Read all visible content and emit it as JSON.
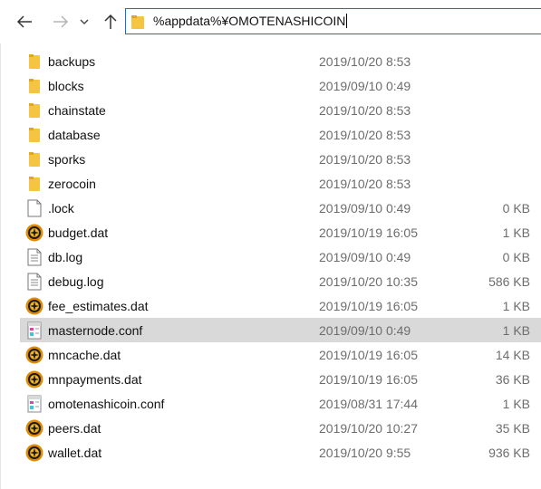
{
  "address_bar": {
    "path": "%appdata%¥OMOTENASHICOIN"
  },
  "colors": {
    "folder": "#f5c542",
    "selection": "#d9d9d9",
    "coin_outer": "#e08a00",
    "coin_inner": "#1a1a1a",
    "accent_border": "#0a74d6"
  },
  "files": [
    {
      "name": "backups",
      "date": "2019/10/20 8:53",
      "size": "",
      "icon": "folder-icon"
    },
    {
      "name": "blocks",
      "date": "2019/09/10 0:49",
      "size": "",
      "icon": "folder-icon"
    },
    {
      "name": "chainstate",
      "date": "2019/10/20 8:53",
      "size": "",
      "icon": "folder-icon"
    },
    {
      "name": "database",
      "date": "2019/10/20 8:53",
      "size": "",
      "icon": "folder-icon"
    },
    {
      "name": "sporks",
      "date": "2019/10/20 8:53",
      "size": "",
      "icon": "folder-icon"
    },
    {
      "name": "zerocoin",
      "date": "2019/10/20 8:53",
      "size": "",
      "icon": "folder-icon"
    },
    {
      "name": ".lock",
      "date": "2019/09/10 0:49",
      "size": "0 KB",
      "icon": "blank-file-icon"
    },
    {
      "name": "budget.dat",
      "date": "2019/10/19 16:05",
      "size": "1 KB",
      "icon": "coin-file-icon"
    },
    {
      "name": "db.log",
      "date": "2019/09/10 0:49",
      "size": "0 KB",
      "icon": "text-file-icon"
    },
    {
      "name": "debug.log",
      "date": "2019/10/20 10:35",
      "size": "586 KB",
      "icon": "text-file-icon"
    },
    {
      "name": "fee_estimates.dat",
      "date": "2019/10/19 16:05",
      "size": "1 KB",
      "icon": "coin-file-icon"
    },
    {
      "name": "masternode.conf",
      "date": "2019/09/10 0:49",
      "size": "1 KB",
      "icon": "config-file-icon",
      "selected": true
    },
    {
      "name": "mncache.dat",
      "date": "2019/10/19 16:05",
      "size": "14 KB",
      "icon": "coin-file-icon"
    },
    {
      "name": "mnpayments.dat",
      "date": "2019/10/19 16:05",
      "size": "36 KB",
      "icon": "coin-file-icon"
    },
    {
      "name": "omotenashicoin.conf",
      "date": "2019/08/31 17:44",
      "size": "1 KB",
      "icon": "config-file-icon"
    },
    {
      "name": "peers.dat",
      "date": "2019/10/20 10:27",
      "size": "35 KB",
      "icon": "coin-file-icon"
    },
    {
      "name": "wallet.dat",
      "date": "2019/10/20 9:55",
      "size": "936 KB",
      "icon": "coin-file-icon"
    }
  ]
}
